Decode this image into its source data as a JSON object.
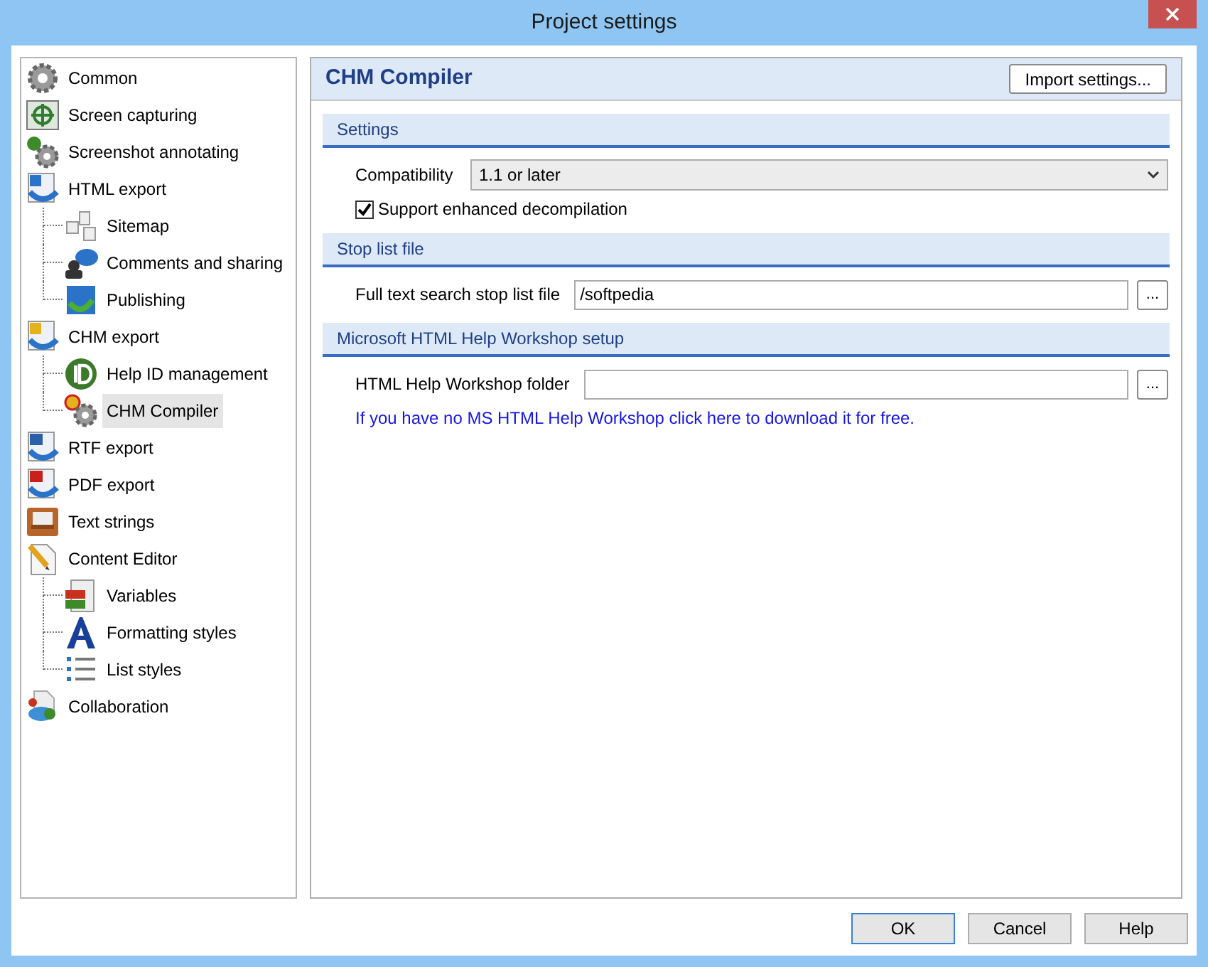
{
  "window": {
    "title": "Project settings"
  },
  "tree": [
    {
      "label": "Common",
      "selected": false
    },
    {
      "label": "Screen capturing",
      "selected": false
    },
    {
      "label": "Screenshot annotating",
      "selected": false
    },
    {
      "label": "HTML export",
      "selected": false,
      "children": [
        {
          "label": "Sitemap",
          "selected": false
        },
        {
          "label": "Comments and sharing",
          "selected": false
        },
        {
          "label": "Publishing",
          "selected": false
        }
      ]
    },
    {
      "label": "CHM export",
      "selected": false,
      "children": [
        {
          "label": "Help ID management",
          "selected": false
        },
        {
          "label": "CHM Compiler",
          "selected": true
        }
      ]
    },
    {
      "label": "RTF export",
      "selected": false
    },
    {
      "label": "PDF export",
      "selected": false
    },
    {
      "label": "Text strings",
      "selected": false
    },
    {
      "label": "Content Editor",
      "selected": false,
      "children": [
        {
          "label": "Variables",
          "selected": false
        },
        {
          "label": "Formatting styles",
          "selected": false
        },
        {
          "label": "List styles",
          "selected": false
        }
      ]
    },
    {
      "label": "Collaboration",
      "selected": false
    }
  ],
  "panel": {
    "title": "CHM Compiler",
    "import_button": "Import settings...",
    "sections": [
      {
        "title": "Settings",
        "fields": [
          {
            "kind": "dropdown",
            "label": "Compatibility",
            "value": "1.1 or later"
          },
          {
            "kind": "checkbox",
            "label": "Support enhanced decompilation",
            "checked": true
          }
        ]
      },
      {
        "title": "Stop list file",
        "fields": [
          {
            "kind": "file",
            "label": "Full text search stop list file",
            "value": "/softpedia",
            "browse": "..."
          }
        ]
      },
      {
        "title": "Microsoft HTML Help Workshop setup",
        "fields": [
          {
            "kind": "file",
            "label": "HTML Help Workshop folder",
            "browse": "..."
          },
          {
            "kind": "link",
            "text": "If you have no MS HTML Help Workshop click here to download it for free."
          }
        ]
      }
    ]
  },
  "buttons": [
    {
      "label": "OK",
      "default": true
    },
    {
      "label": "Cancel",
      "default": false
    },
    {
      "label": "Help",
      "default": false
    }
  ]
}
